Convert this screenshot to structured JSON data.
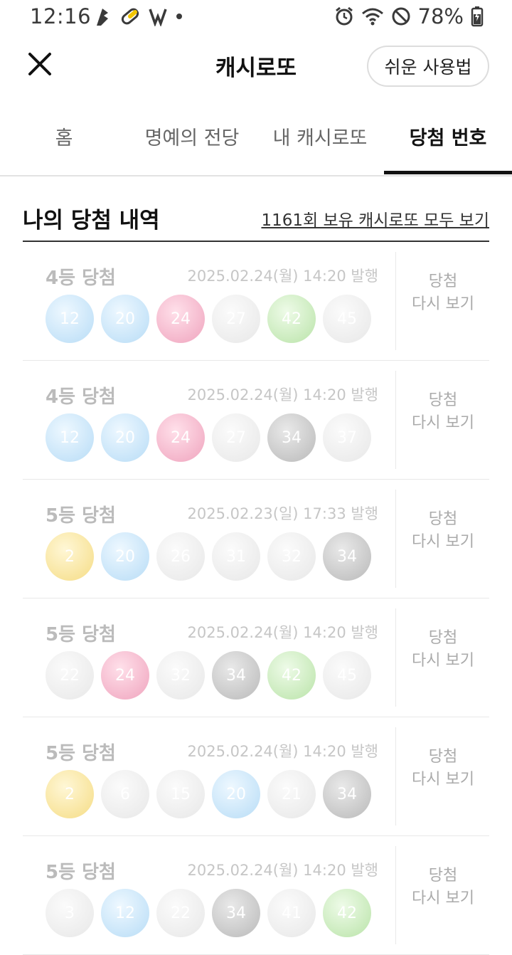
{
  "status_bar": {
    "time": "12:16",
    "battery_percent": "78%",
    "left_icons": [
      "flame-app-icon",
      "pill-app-icon",
      "v-app-icon",
      "dot-icon"
    ],
    "right_icons": [
      "alarm-icon",
      "wifi-icon",
      "do-not-disturb-icon",
      "battery-charging-icon"
    ]
  },
  "header": {
    "title": "캐시로또",
    "help_label": "쉬운 사용법"
  },
  "tabs": [
    {
      "label": "홈",
      "active": false
    },
    {
      "label": "명예의 전당",
      "active": false
    },
    {
      "label": "내 캐시로또",
      "active": false
    },
    {
      "label": "당첨 번호",
      "active": true
    }
  ],
  "section": {
    "title": "나의 당첨 내역",
    "view_all": "1161회 보유 캐시로또 모두 보기"
  },
  "review_label_line1": "당첨",
  "review_label_line2": "다시 보기",
  "entries": [
    {
      "rank": "4등 당첨",
      "date": "2025.02.24(월) 14:20 발행",
      "balls": [
        {
          "n": "12",
          "c": "blue"
        },
        {
          "n": "20",
          "c": "blue"
        },
        {
          "n": "24",
          "c": "pink"
        },
        {
          "n": "27",
          "c": "gray"
        },
        {
          "n": "42",
          "c": "green"
        },
        {
          "n": "45",
          "c": "gray"
        }
      ]
    },
    {
      "rank": "4등 당첨",
      "date": "2025.02.24(월) 14:20 발행",
      "balls": [
        {
          "n": "12",
          "c": "blue"
        },
        {
          "n": "20",
          "c": "blue"
        },
        {
          "n": "24",
          "c": "pink"
        },
        {
          "n": "27",
          "c": "gray"
        },
        {
          "n": "34",
          "c": "dark"
        },
        {
          "n": "37",
          "c": "gray"
        }
      ]
    },
    {
      "rank": "5등 당첨",
      "date": "2025.02.23(일) 17:33 발행",
      "balls": [
        {
          "n": "2",
          "c": "yellow"
        },
        {
          "n": "20",
          "c": "blue"
        },
        {
          "n": "26",
          "c": "gray"
        },
        {
          "n": "31",
          "c": "gray"
        },
        {
          "n": "32",
          "c": "gray"
        },
        {
          "n": "34",
          "c": "dark"
        }
      ]
    },
    {
      "rank": "5등 당첨",
      "date": "2025.02.24(월) 14:20 발행",
      "balls": [
        {
          "n": "22",
          "c": "gray"
        },
        {
          "n": "24",
          "c": "pink"
        },
        {
          "n": "32",
          "c": "gray"
        },
        {
          "n": "34",
          "c": "dark"
        },
        {
          "n": "42",
          "c": "green"
        },
        {
          "n": "45",
          "c": "gray"
        }
      ]
    },
    {
      "rank": "5등 당첨",
      "date": "2025.02.24(월) 14:20 발행",
      "balls": [
        {
          "n": "2",
          "c": "yellow"
        },
        {
          "n": "6",
          "c": "gray"
        },
        {
          "n": "15",
          "c": "gray"
        },
        {
          "n": "20",
          "c": "blue"
        },
        {
          "n": "21",
          "c": "gray"
        },
        {
          "n": "34",
          "c": "dark"
        }
      ]
    },
    {
      "rank": "5등 당첨",
      "date": "2025.02.24(월) 14:20 발행",
      "balls": [
        {
          "n": "3",
          "c": "gray"
        },
        {
          "n": "12",
          "c": "blue"
        },
        {
          "n": "22",
          "c": "gray"
        },
        {
          "n": "34",
          "c": "dark"
        },
        {
          "n": "41",
          "c": "gray"
        },
        {
          "n": "42",
          "c": "green"
        }
      ]
    }
  ],
  "colors": {
    "accent": "#111111",
    "ball_yellow": "#f5dc84",
    "ball_blue": "#b7dcf6",
    "ball_pink": "#efa3bd",
    "ball_gray": "#e7e7e7",
    "ball_dark": "#b9b9b9",
    "ball_green": "#b9e3a8"
  }
}
